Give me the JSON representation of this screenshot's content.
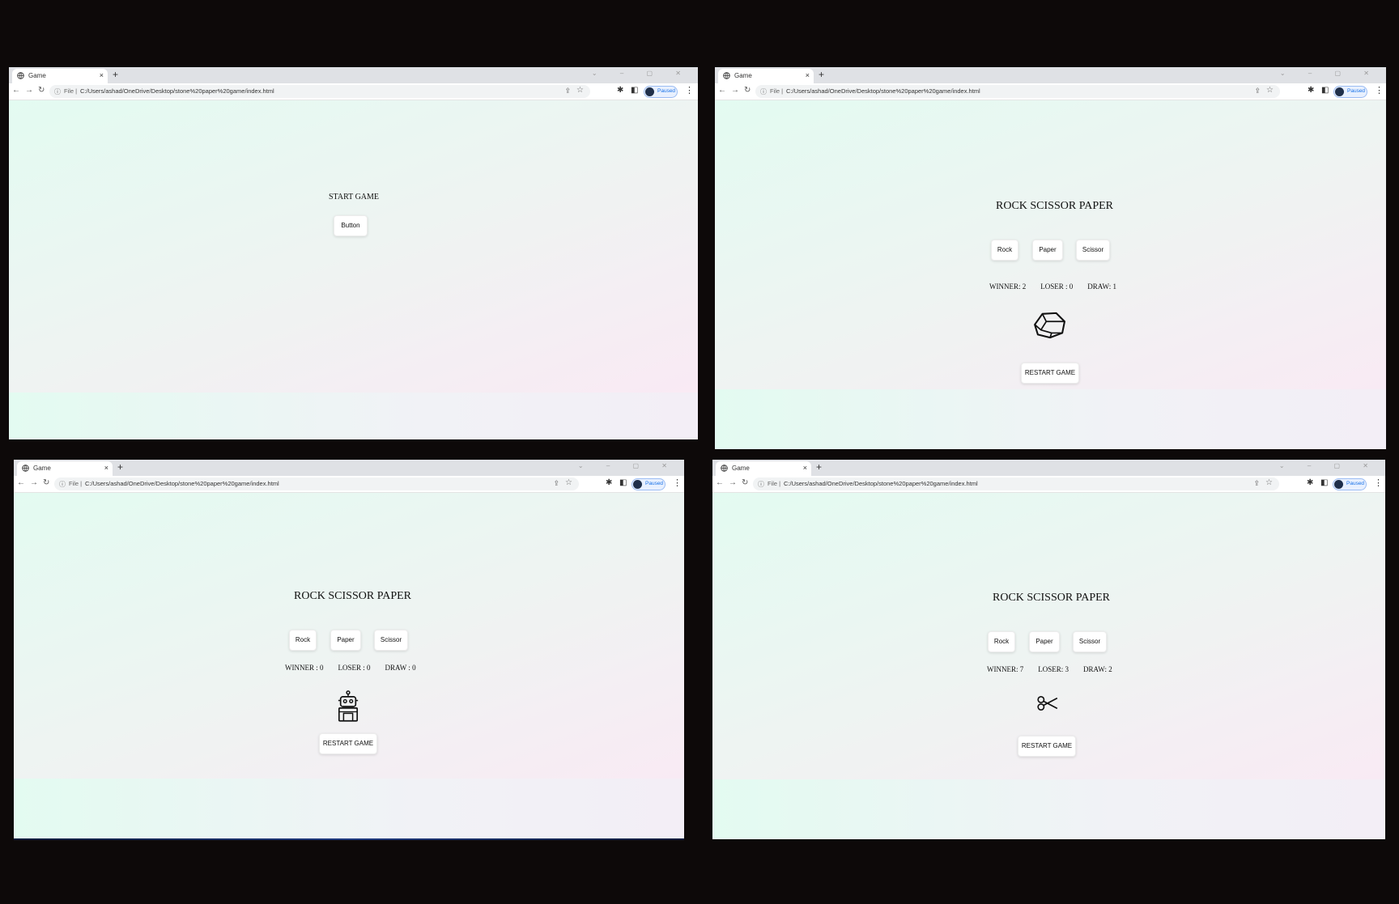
{
  "browser": {
    "tab_title": "Game",
    "new_tab_glyph": "+",
    "close_glyph": "×",
    "file_label": "File |",
    "url": "C:/Users/ashad/OneDrive/Desktop/stone%20paper%20game/index.html",
    "profile_status": "Paused",
    "window_controls": "⌄ – ▢ ✕"
  },
  "screen1": {
    "heading": "START GAME",
    "start_button": "Button"
  },
  "game": {
    "title": "ROCK SCISSOR PAPER",
    "rock_button": "Rock",
    "paper_button": "Paper",
    "scissor_button": "Scissor",
    "restart_button": "RESTART GAME"
  },
  "screen2": {
    "winner": "WINNER:  2",
    "loser": "LOSER : 0",
    "draw": "DRAW: 1",
    "icon": "rock-icon"
  },
  "screen3": {
    "winner": "WINNER  :  0",
    "loser": "LOSER : 0",
    "draw": "DRAW : 0",
    "icon": "robot-icon"
  },
  "screen4": {
    "winner": "WINNER:  7",
    "loser": "LOSER: 3",
    "draw": "DRAW: 2",
    "icon": "scissors-icon"
  }
}
